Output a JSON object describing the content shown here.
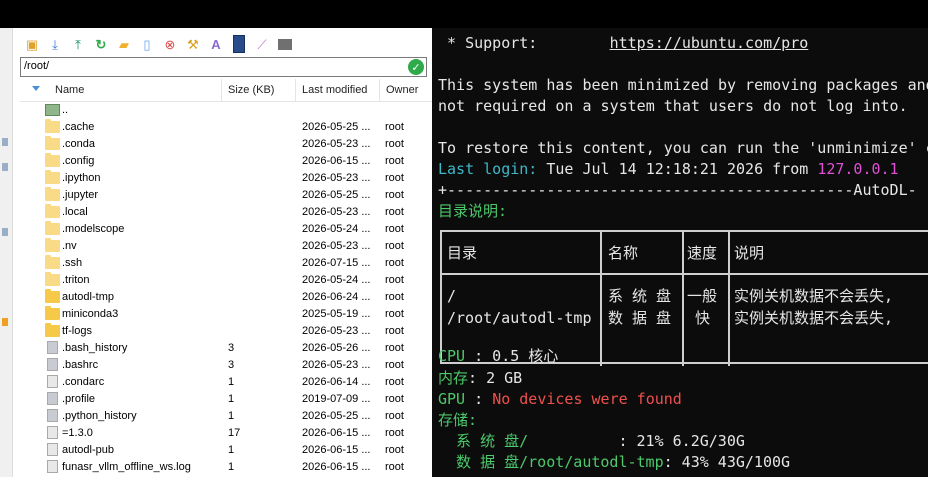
{
  "left_panel": {
    "path": "/root/",
    "columns": {
      "name": "Name",
      "size": "Size (KB)",
      "modified": "Last modified",
      "owner": "Owner"
    },
    "up_label": "..",
    "rows": [
      {
        "name": ".cache",
        "size": "",
        "modified": "2026-05-25 ...",
        "owner": "root",
        "kind": "folder-dot"
      },
      {
        "name": ".conda",
        "size": "",
        "modified": "2026-05-23 ...",
        "owner": "root",
        "kind": "folder-dot"
      },
      {
        "name": ".config",
        "size": "",
        "modified": "2026-06-15 ...",
        "owner": "root",
        "kind": "folder-dot"
      },
      {
        "name": ".ipython",
        "size": "",
        "modified": "2026-05-23 ...",
        "owner": "root",
        "kind": "folder-dot"
      },
      {
        "name": ".jupyter",
        "size": "",
        "modified": "2026-05-25 ...",
        "owner": "root",
        "kind": "folder-dot"
      },
      {
        "name": ".local",
        "size": "",
        "modified": "2026-05-23 ...",
        "owner": "root",
        "kind": "folder-dot"
      },
      {
        "name": ".modelscope",
        "size": "",
        "modified": "2026-05-24 ...",
        "owner": "root",
        "kind": "folder-dot"
      },
      {
        "name": ".nv",
        "size": "",
        "modified": "2026-05-23 ...",
        "owner": "root",
        "kind": "folder-dot"
      },
      {
        "name": ".ssh",
        "size": "",
        "modified": "2026-07-15 ...",
        "owner": "root",
        "kind": "folder-dot"
      },
      {
        "name": ".triton",
        "size": "",
        "modified": "2026-05-24 ...",
        "owner": "root",
        "kind": "folder-dot"
      },
      {
        "name": "autodl-tmp",
        "size": "",
        "modified": "2026-06-24 ...",
        "owner": "root",
        "kind": "folder"
      },
      {
        "name": "miniconda3",
        "size": "",
        "modified": "2025-05-19 ...",
        "owner": "root",
        "kind": "folder"
      },
      {
        "name": "tf-logs",
        "size": "",
        "modified": "2026-05-23 ...",
        "owner": "root",
        "kind": "folder"
      },
      {
        "name": ".bash_history",
        "size": "3",
        "modified": "2026-05-26 ...",
        "owner": "root",
        "kind": "file-img"
      },
      {
        "name": ".bashrc",
        "size": "3",
        "modified": "2026-05-23 ...",
        "owner": "root",
        "kind": "file-img"
      },
      {
        "name": ".condarc",
        "size": "1",
        "modified": "2026-06-14 ...",
        "owner": "root",
        "kind": "file"
      },
      {
        "name": ".profile",
        "size": "1",
        "modified": "2019-07-09 ...",
        "owner": "root",
        "kind": "file-img"
      },
      {
        "name": ".python_history",
        "size": "1",
        "modified": "2026-05-25 ...",
        "owner": "root",
        "kind": "file-img"
      },
      {
        "name": "=1.3.0",
        "size": "17",
        "modified": "2026-06-15 ...",
        "owner": "root",
        "kind": "file"
      },
      {
        "name": "autodl-pub",
        "size": "1",
        "modified": "2026-06-15 ...",
        "owner": "root",
        "kind": "shortcut"
      },
      {
        "name": "funasr_vllm_offline_ws.log",
        "size": "1",
        "modified": "2026-06-15 ...",
        "owner": "root",
        "kind": "file"
      }
    ],
    "toolbar_icons": [
      "refresh-folder-icon",
      "download-icon",
      "upload-icon",
      "sync-icon",
      "new-folder-icon",
      "new-file-icon",
      "delete-icon",
      "properties-icon",
      "rename-icon",
      "view-icon",
      "edit-icon",
      "terminal-icon"
    ]
  },
  "terminal": {
    "support_label": " * Support:        ",
    "support_url": "https://ubuntu.com/pro",
    "minimized_1": "This system has been minimized by removing packages and",
    "minimized_2": "not required on a system that users do not log into.",
    "restore": "To restore this content, you can run the 'unminimize' c",
    "last_login_label": "Last login:",
    "last_login_text": " Tue Jul 14 12:18:21 2026 from ",
    "last_login_ip": "127.0.0.1",
    "divider": "+---------------------------------------------AutoDL-",
    "dir_title": "目录说明:",
    "table": {
      "h_dir": "目录",
      "h_name": "名称",
      "h_speed": "速度",
      "h_desc": "说明",
      "r1_dir_a": "/",
      "r1_dir_b": "/root/autodl-tmp",
      "r1_name_a": "系 统 盘",
      "r1_name_b": "数 据 盘",
      "r1_speed_a": "一般",
      "r1_speed_b": "快",
      "r1_desc_a": "实例关机数据不会丢失,",
      "r1_desc_b": "实例关机数据不会丢失,"
    },
    "cpu_label": "CPU",
    "cpu_value": " : 0.5 核心",
    "mem_label": "内存",
    "mem_value": ": 2 GB",
    "gpu_label": "GPU",
    "gpu_sep": " : ",
    "gpu_value": "No devices were found",
    "storage_label": "存储:",
    "sys_disk_label": "  系 统 盘/",
    "sys_disk_value": "          : 21% 6.2G/30G",
    "data_disk_label": "  数 据 盘/root/autodl-tmp",
    "data_disk_value": ": 43% 43G/100G"
  }
}
